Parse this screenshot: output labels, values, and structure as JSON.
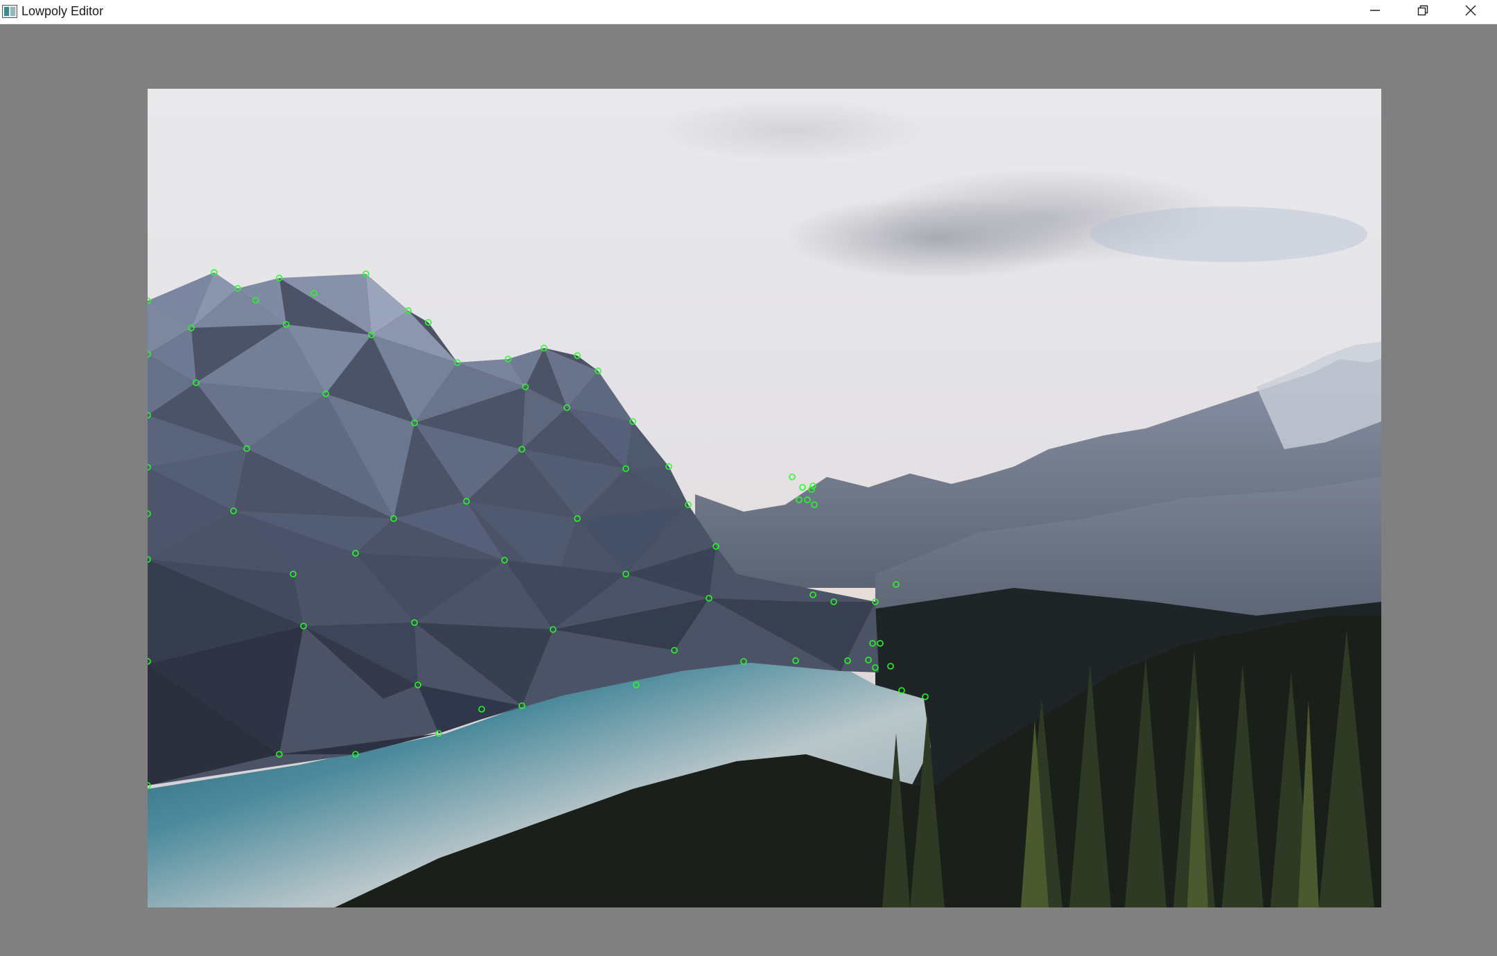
{
  "window": {
    "title": "Lowpoly Editor",
    "icons": {
      "app": "lowpoly-app-icon",
      "minimize": "minimize-icon",
      "restore": "restore-icon",
      "close": "close-icon"
    }
  },
  "editor": {
    "image_subject": "mountain-lake-landscape",
    "point_marker_color": "#22ff22",
    "background_color": "#808080"
  }
}
